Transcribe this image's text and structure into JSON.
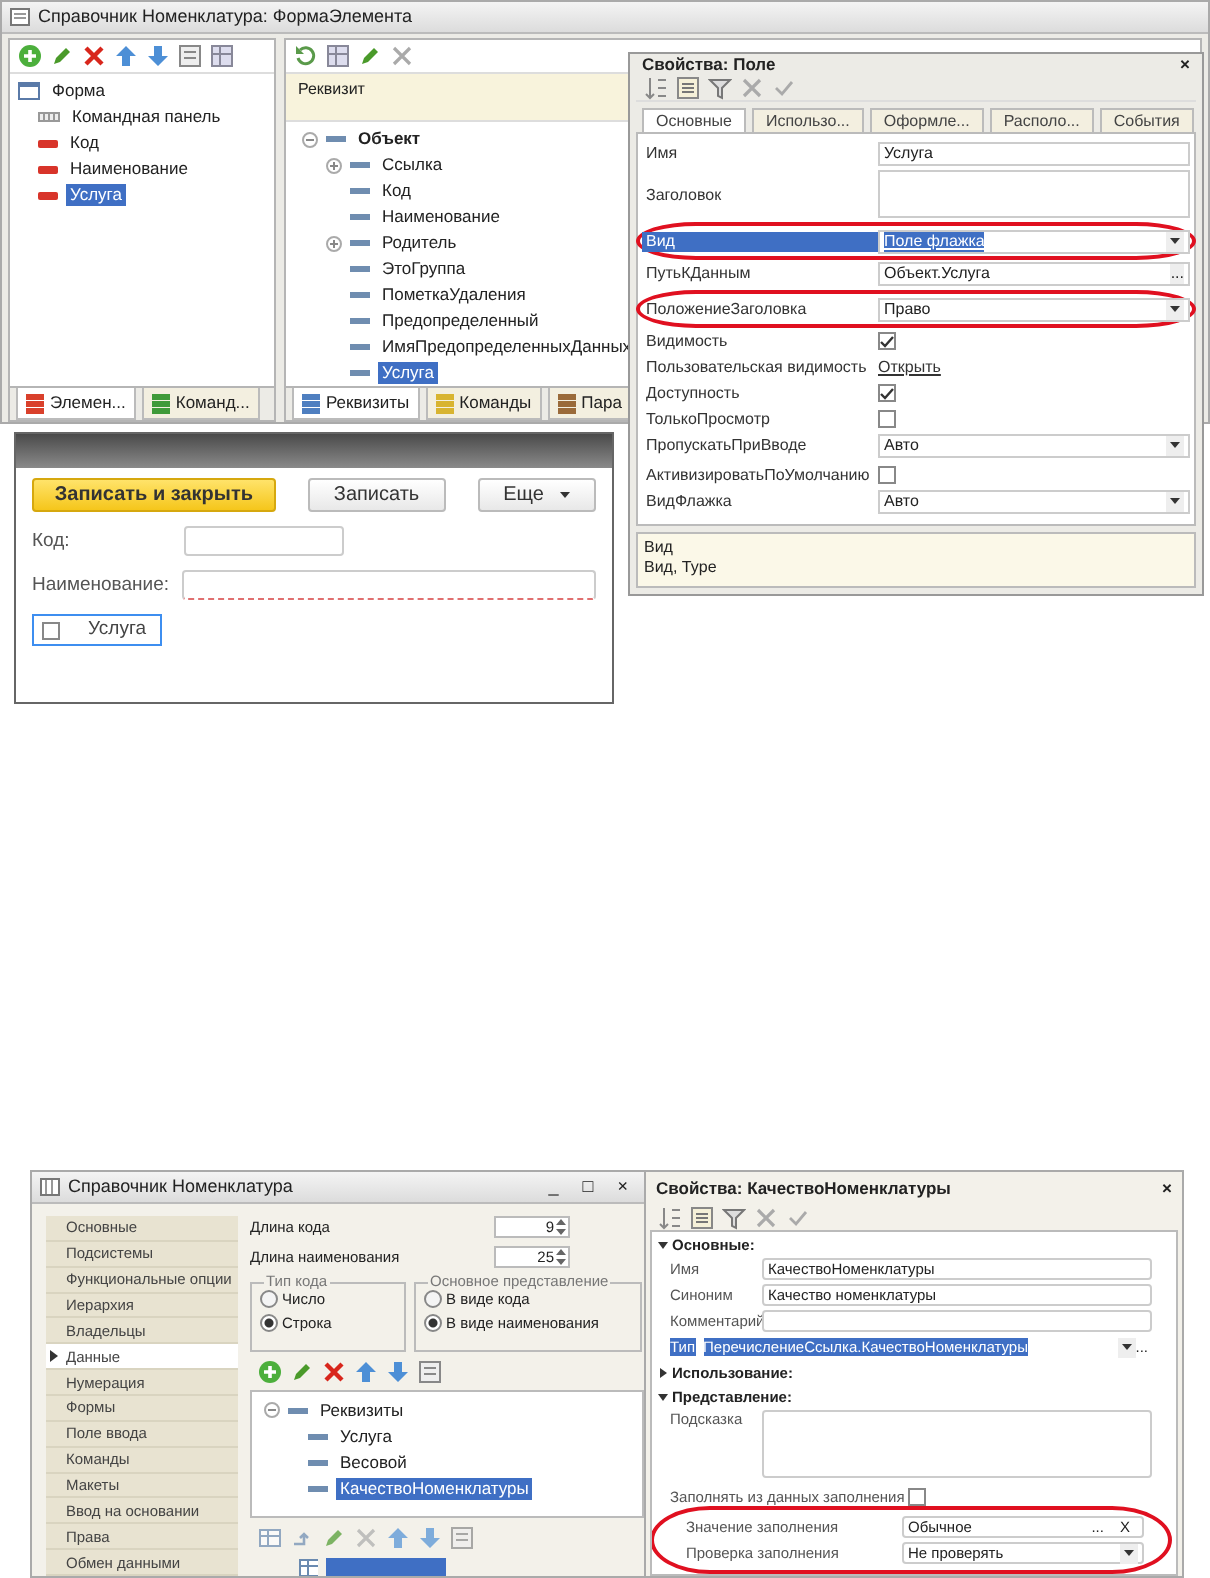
{
  "top_window": {
    "title": "Справочник Номенклатура: ФормаЭлемента",
    "elements_panel": {
      "tree": [
        {
          "label": "Форма",
          "kind": "form",
          "selected": false,
          "children": [
            {
              "label": "Командная панель",
              "kind": "command_bar",
              "selected": false
            },
            {
              "label": "Код",
              "kind": "field",
              "selected": false
            },
            {
              "label": "Наименование",
              "kind": "field",
              "selected": false
            },
            {
              "label": "Услуга",
              "kind": "field",
              "selected": true
            }
          ]
        }
      ],
      "tabs": [
        {
          "label": "Элемен...",
          "selected": true,
          "color": "#d9402b"
        },
        {
          "label": "Команд...",
          "selected": false,
          "color": "#3f9a3a"
        }
      ]
    },
    "attributes_panel": {
      "column": "Реквизит",
      "tree": [
        {
          "label": "Объект",
          "expanded": true,
          "selected": false,
          "children": [
            {
              "label": "Ссылка",
              "expanded": false,
              "selected": false
            },
            {
              "label": "Код",
              "selected": false
            },
            {
              "label": "Наименование",
              "selected": false
            },
            {
              "label": "Родитель",
              "expanded": false,
              "selected": false
            },
            {
              "label": "ЭтоГруппа",
              "selected": false
            },
            {
              "label": "ПометкаУдаления",
              "selected": false
            },
            {
              "label": "Предопределенный",
              "selected": false
            },
            {
              "label": "ИмяПредопределенныхДанных",
              "selected": false
            },
            {
              "label": "Услуга",
              "selected": true
            }
          ]
        }
      ],
      "tabs": [
        {
          "label": "Реквизиты",
          "selected": true,
          "color": "#4f7fc0"
        },
        {
          "label": "Команды",
          "selected": false,
          "color": "#d8b431"
        },
        {
          "label": "Пара",
          "selected": false,
          "color": "#9a6a3a"
        }
      ]
    },
    "form_preview": {
      "buttons": [
        {
          "label": "Записать и закрыть",
          "kind": "default"
        },
        {
          "label": "Записать",
          "kind": "plain"
        },
        {
          "label": "Еще",
          "kind": "menu"
        }
      ],
      "fields": [
        {
          "label": "Код:",
          "required": false
        },
        {
          "label": "Наименование:",
          "required": true
        }
      ],
      "checkbox": {
        "label": "Услуга",
        "checked": false,
        "focused": true
      }
    }
  },
  "properties_window": {
    "title": "Свойства: Поле",
    "close": "×",
    "tabs": [
      {
        "label": "Основные",
        "selected": true
      },
      {
        "label": "Использо...",
        "selected": false
      },
      {
        "label": "Оформле...",
        "selected": false
      },
      {
        "label": "Располо...",
        "selected": false
      },
      {
        "label": "События",
        "selected": false
      }
    ],
    "rows": [
      {
        "label": "Имя",
        "kind": "text",
        "value": "Услуга",
        "selected": false
      },
      {
        "label": "Заголовок",
        "kind": "textarea",
        "selected": false
      },
      {
        "label": "Вид",
        "kind": "select",
        "value": "Поле флажка",
        "selected": true,
        "circled": true
      },
      {
        "label": "ПутьКДанным",
        "kind": "picker",
        "value": "Объект.Услуга",
        "button": "...",
        "selected": false
      },
      {
        "label": "ПоложениеЗаголовка",
        "kind": "select",
        "value": "Право",
        "selected": false,
        "circled": true
      },
      {
        "label": "Видимость",
        "kind": "check",
        "checked": true,
        "selected": false
      },
      {
        "label": "Пользовательская видимость",
        "kind": "link",
        "value": "Открыть",
        "selected": false
      },
      {
        "label": "Доступность",
        "kind": "check",
        "checked": true,
        "selected": false
      },
      {
        "label": "ТолькоПросмотр",
        "kind": "check",
        "checked": false,
        "selected": false
      },
      {
        "label": "ПропускатьПриВводе",
        "kind": "select",
        "value": "Авто",
        "selected": false
      },
      {
        "label": "АктивизироватьПоУмолчанию",
        "kind": "check",
        "checked": false,
        "selected": false
      },
      {
        "label": "ВидФлажка",
        "kind": "select",
        "value": "Авто",
        "selected": false
      }
    ],
    "description": [
      "Вид",
      "Вид, Type"
    ]
  },
  "bottom_window": {
    "title": "Справочник Номенклатура",
    "controls": [
      "_",
      "□",
      "×"
    ],
    "nav": [
      {
        "label": "Основные",
        "selected": false
      },
      {
        "label": "Подсистемы",
        "selected": false
      },
      {
        "label": "Функциональные опции",
        "selected": false
      },
      {
        "label": "Иерархия",
        "selected": false
      },
      {
        "label": "Владельцы",
        "selected": false
      },
      {
        "label": "Данные",
        "selected": true
      },
      {
        "label": "Нумерация",
        "selected": false
      },
      {
        "label": "Формы",
        "selected": false
      },
      {
        "label": "Поле ввода",
        "selected": false
      },
      {
        "label": "Команды",
        "selected": false
      },
      {
        "label": "Макеты",
        "selected": false
      },
      {
        "label": "Ввод на основании",
        "selected": false
      },
      {
        "label": "Права",
        "selected": false
      },
      {
        "label": "Обмен данными",
        "selected": false
      }
    ],
    "spins": [
      {
        "label": "Длина кода",
        "value": "9"
      },
      {
        "label": "Длина наименования",
        "value": "25"
      }
    ],
    "groups": [
      {
        "title": "Тип кода",
        "options": [
          {
            "label": "Число",
            "selected": false
          },
          {
            "label": "Строка",
            "selected": true
          }
        ]
      },
      {
        "title": "Основное представление",
        "options": [
          {
            "label": "В виде кода",
            "selected": false
          },
          {
            "label": "В виде наименования",
            "selected": true
          }
        ]
      }
    ],
    "tree": [
      {
        "label": "Реквизиты",
        "expanded": true,
        "selected": false,
        "children": [
          {
            "label": "Услуга",
            "selected": false
          },
          {
            "label": "Весовой",
            "selected": false
          },
          {
            "label": "КачествоНоменклатуры",
            "selected": true
          }
        ]
      }
    ]
  },
  "bottom_properties": {
    "title": "Свойства: КачествоНоменклатуры",
    "close": "×",
    "items": [
      {
        "kind": "section",
        "label": "Основные:",
        "expanded": true
      },
      {
        "kind": "text",
        "label": "Имя",
        "value": "КачествоНоменклатуры"
      },
      {
        "kind": "text",
        "label": "Синоним",
        "value": "Качество номенклатуры"
      },
      {
        "kind": "text",
        "label": "Комментарий"
      },
      {
        "kind": "type",
        "label": "Тип",
        "value": "ПеречислениеСсылка.КачествоНоменклатуры",
        "selected": true,
        "button": "..."
      },
      {
        "kind": "section",
        "label": "Использование:",
        "expanded": false
      },
      {
        "kind": "section",
        "label": "Представление:",
        "expanded": true
      },
      {
        "kind": "textarea",
        "label": "Подсказка"
      },
      {
        "kind": "check",
        "label": "Заполнять из данных заполнения",
        "checked": false
      },
      {
        "kind": "group",
        "circled": true,
        "rows": [
          {
            "kind": "picker",
            "label": "Значение заполнения",
            "value": "Обычное",
            "button": "...",
            "clear": "X"
          },
          {
            "kind": "select",
            "label": "Проверка заполнения",
            "value": "Не проверять"
          }
        ]
      }
    ]
  }
}
